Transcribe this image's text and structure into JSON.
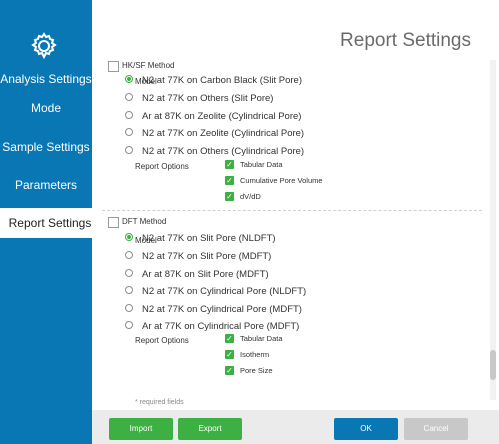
{
  "sidebar": {
    "items": [
      {
        "label": "Analysis Settings"
      },
      {
        "label": "Mode"
      },
      {
        "label": "Sample Settings"
      },
      {
        "label": "Parameters"
      },
      {
        "label": "Report Settings"
      }
    ]
  },
  "header": {
    "title": "Report Settings"
  },
  "hksf": {
    "section_label": "HK/SF Method",
    "model_label": "Model",
    "models": [
      "N2 at 77K on Carbon Black (Slit Pore)",
      "N2 at 77K on Others (Slit Pore)",
      "Ar at 87K on Zeolite (Cylindrical Pore)",
      "N2 at 77K on Zeolite (Cylindrical Pore)",
      "N2 at 77K on Others (Cylindrical Pore)"
    ],
    "selected_model_index": 0,
    "report_label": "Report Options",
    "options": [
      "Tabular Data",
      "Cumulative Pore Volume",
      "dV/dD"
    ]
  },
  "dft": {
    "section_label": "DFT Method",
    "model_label": "Model",
    "models": [
      "N2 at 77K on Slit Pore (NLDFT)",
      "N2 at 77K on Slit Pore (MDFT)",
      "Ar at 87K on Slit Pore (MDFT)",
      "N2 at 77K on Cylindrical Pore (NLDFT)",
      "N2 at 77K on Cylindrical Pore (MDFT)",
      "Ar at 77K on Cylindrical Pore (MDFT)"
    ],
    "selected_model_index": 0,
    "report_label": "Report Options",
    "options": [
      "Tabular Data",
      "Isotherm",
      "Pore Size"
    ]
  },
  "required_note": "* required fields",
  "footer": {
    "import_label": "Import",
    "export_label": "Export",
    "ok_label": "OK",
    "cancel_label": "Cancel"
  },
  "colors": {
    "sidebar": "#0a77b5",
    "accent_green": "#3cb043",
    "ok_blue": "#0a77b5",
    "cancel_gray": "#c8c8c8"
  },
  "icons": {
    "sidebar_top": "gear-icon"
  }
}
